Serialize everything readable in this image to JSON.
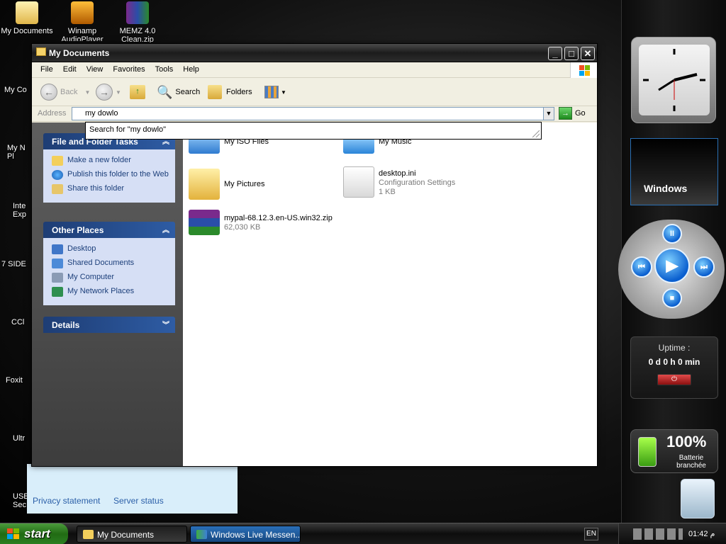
{
  "desktop": {
    "icons": [
      {
        "label": "My Documents"
      },
      {
        "label": "Winamp AudioPlayer"
      },
      {
        "label": "MEMZ 4.0 Clean.zip"
      }
    ],
    "partial_labels": [
      "My Co",
      "My N Pl",
      "Inte Exp",
      "7 SIDE",
      "CCl",
      "Foxit",
      "Ultr",
      "USE Sec"
    ]
  },
  "window": {
    "title": "My Documents",
    "menu": [
      "File",
      "Edit",
      "View",
      "Favorites",
      "Tools",
      "Help"
    ],
    "toolbar": {
      "back": "Back",
      "search": "Search",
      "folders": "Folders"
    },
    "address": {
      "label": "Address",
      "value": "my dowlo",
      "go": "Go"
    },
    "autocomplete": "Search for \"my dowlo\"",
    "tasks_panel": {
      "title": "File and Folder Tasks",
      "items": [
        "Make a new folder",
        "Publish this folder to the Web",
        "Share this folder"
      ]
    },
    "places_panel": {
      "title": "Other Places",
      "items": [
        "Desktop",
        "Shared Documents",
        "My Computer",
        "My Network Places"
      ]
    },
    "details_panel": {
      "title": "Details"
    },
    "files": [
      {
        "name": "My ISO Files"
      },
      {
        "name": "My Music"
      },
      {
        "name": "My Pictures"
      },
      {
        "name": "desktop.ini",
        "type": "Configuration Settings",
        "size": "1 KB"
      },
      {
        "name": "mypal-68.12.3.en-US.win32.zip",
        "size": "62,030 KB"
      }
    ]
  },
  "background_panel": {
    "links": [
      "Privacy statement",
      "Server status"
    ]
  },
  "gadgets": {
    "windows_label": "Windows",
    "uptime_title": "Uptime :",
    "uptime_value": "0 d 0 h 0 min",
    "battery_pct": "100%",
    "battery_label": "Batterie branchée"
  },
  "taskbar": {
    "start": "start",
    "tasks": [
      "My Documents",
      "Windows Live Messen..."
    ],
    "lang": "EN",
    "clock": "01:42 م"
  },
  "colors": {
    "accent": "#2e5ca4",
    "link": "#1c3f7a",
    "start_green": "#216b13"
  }
}
